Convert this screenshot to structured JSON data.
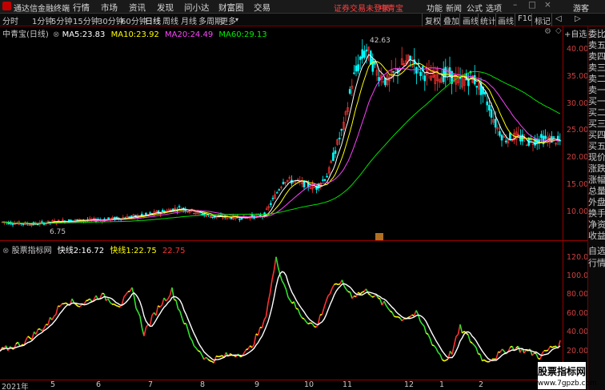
{
  "menubar": {
    "app_name": "通达信金融终端",
    "items": [
      "行情",
      "市场",
      "资讯",
      "发现",
      "问小达",
      "财富圈",
      "交易"
    ],
    "notice": "证券交易未登录",
    "stock": "中青宝",
    "right_items": [
      "功能",
      "新闻",
      "公式",
      "选项",
      "游客"
    ]
  },
  "toolbar": {
    "periods": [
      "分时",
      "1分钟",
      "5分钟",
      "15分钟",
      "30分钟",
      "60分钟",
      "日线",
      "周线",
      "月线",
      "多周期",
      "更多"
    ],
    "active_period": "日线",
    "right_buttons": [
      "复权",
      "叠加",
      "画线",
      "统计",
      "画线",
      "F10",
      "标记"
    ]
  },
  "main_chart": {
    "name": "中青宝(日线)",
    "ma": [
      {
        "label": "MA5:",
        "value": "23.83",
        "color": "#ffffff"
      },
      {
        "label": "MA10:",
        "value": "23.92",
        "color": "#ffff00"
      },
      {
        "label": "MA20:",
        "value": "24.49",
        "color": "#ff40ff"
      },
      {
        "label": "MA60:",
        "value": "29.13",
        "color": "#00e000"
      }
    ],
    "yticks": [
      "40.00",
      "35.00",
      "30.00",
      "25.00",
      "20.00",
      "15.00",
      "10.00"
    ],
    "high_label": "42.63",
    "low_label": "6.75",
    "marker": "财"
  },
  "sub_chart": {
    "name": "股票指标网",
    "fast2_label": "快线2:",
    "fast2_value": "16.72",
    "fast1_label": "快线1:",
    "fast1_value": "22.75",
    "extra_value": "22.75",
    "yticks": [
      "120.0",
      "100.0",
      "80.00",
      "60.00",
      "40.00",
      "20.00"
    ]
  },
  "dates": [
    "2021年",
    "5",
    "6",
    "7",
    "8",
    "9",
    "10",
    "11",
    "12",
    "1",
    "2"
  ],
  "right_panel": [
    "委比",
    "卖五",
    "卖四",
    "卖三",
    "卖二",
    "卖一",
    "买一",
    "买二",
    "买三",
    "买四",
    "买五",
    "现价",
    "涨跌",
    "涨幅",
    "总量",
    "外盘",
    "换手",
    "净资",
    "收益"
  ],
  "right_panel_bottom": [
    "自选",
    "行情"
  ],
  "watermark": {
    "line1": "股票指标网",
    "line2": "www.7gpzb.com"
  },
  "colors": {
    "up": "#ff3232",
    "down": "#00ffff",
    "axis": "#990000",
    "ma5": "#ffffff",
    "ma10": "#ffff00",
    "ma20": "#ff40ff",
    "ma60": "#00e000"
  }
}
